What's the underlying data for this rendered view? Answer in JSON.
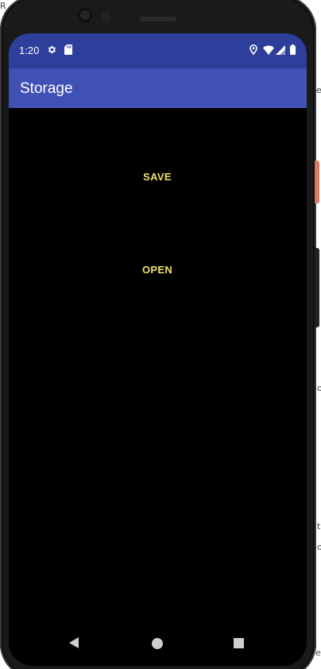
{
  "status_bar": {
    "time": "1:20",
    "icons": [
      "settings-icon",
      "sd-card-icon",
      "location-icon",
      "wifi-icon",
      "signal-icon",
      "battery-icon"
    ],
    "color": "#2d3f9b"
  },
  "app_bar": {
    "title": "Storage",
    "color": "#3f51b5"
  },
  "main": {
    "save_label": "SAVE",
    "open_label": "OPEN",
    "button_text_color": "#f0e06a",
    "background": "#000000"
  },
  "nav_bar": {
    "icons": [
      "back-icon",
      "home-icon",
      "recents-icon"
    ]
  },
  "background_fragments": {
    "top_left": "R",
    "right_1": "e",
    "right_2": "o",
    "right_3": "t",
    "right_4": "o",
    "right_5": "e"
  }
}
